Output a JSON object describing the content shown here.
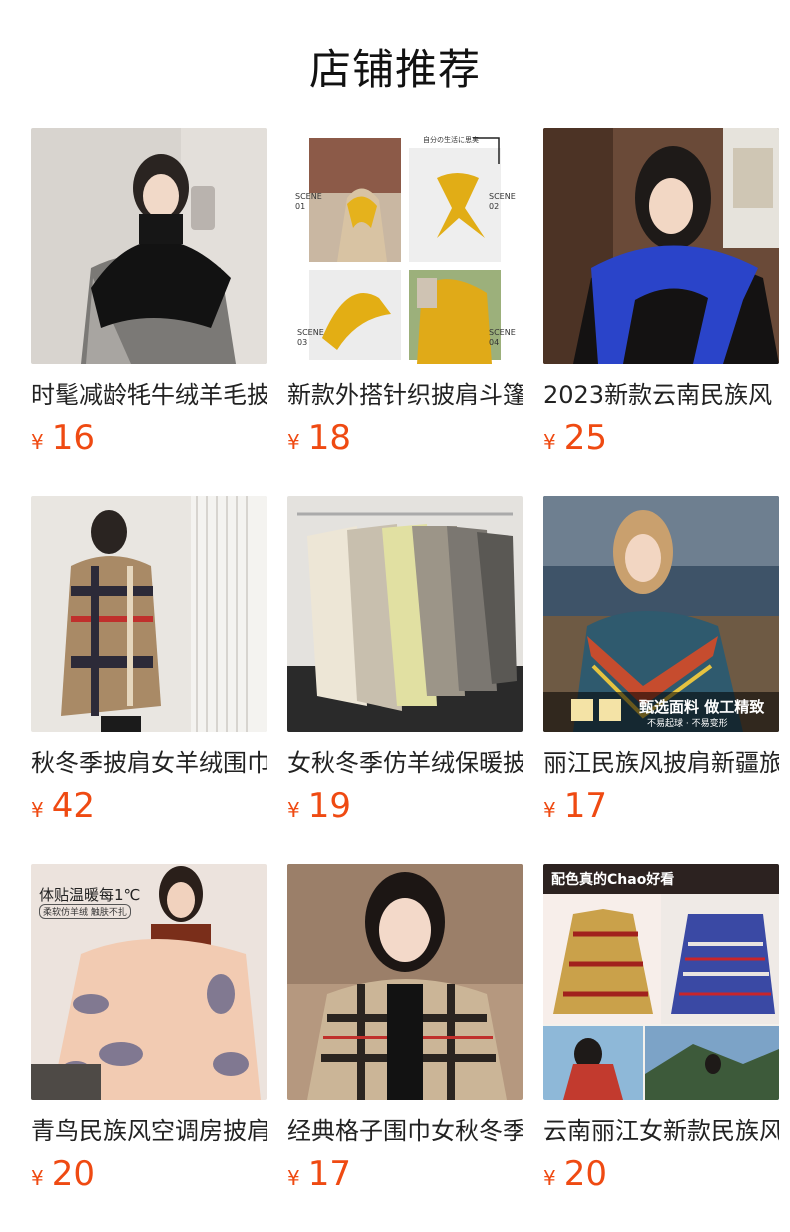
{
  "page": {
    "title": "店铺推荐"
  },
  "products": [
    {
      "name": "时髦减龄牦牛绒羊毛披肩",
      "currency": "¥",
      "price": "16"
    },
    {
      "name": "新款外搭针织披肩斗篷",
      "currency": "¥",
      "price": "18"
    },
    {
      "name": "2023新款云南民族风",
      "currency": "¥",
      "price": "25"
    },
    {
      "name": "秋冬季披肩女羊绒围巾",
      "currency": "¥",
      "price": "42"
    },
    {
      "name": "女秋冬季仿羊绒保暖披",
      "currency": "¥",
      "price": "19"
    },
    {
      "name": "丽江民族风披肩新疆旅",
      "currency": "¥",
      "price": "17"
    },
    {
      "name": "青鸟民族风空调房披肩",
      "currency": "¥",
      "price": "20"
    },
    {
      "name": "经典格子围巾女秋冬季",
      "currency": "¥",
      "price": "17"
    },
    {
      "name": "云南丽江女新款民族风",
      "currency": "¥",
      "price": "20"
    }
  ],
  "image_text": {
    "p2_scene_tag": "自分の生活に思実",
    "p2_scene1": "SCENE 01",
    "p2_scene2": "SCENE 02",
    "p2_scene3": "SCENE 03",
    "p2_scene4": "SCENE 04",
    "p6_banner": "甄选面料 做工精致",
    "p6_sub": "不易起球 · 不易变形",
    "p7_headline": "体贴温暖每1℃",
    "p7_sub": "柔软仿羊绒 触肤不扎",
    "p9_headline": "配色真的Chao好看"
  }
}
